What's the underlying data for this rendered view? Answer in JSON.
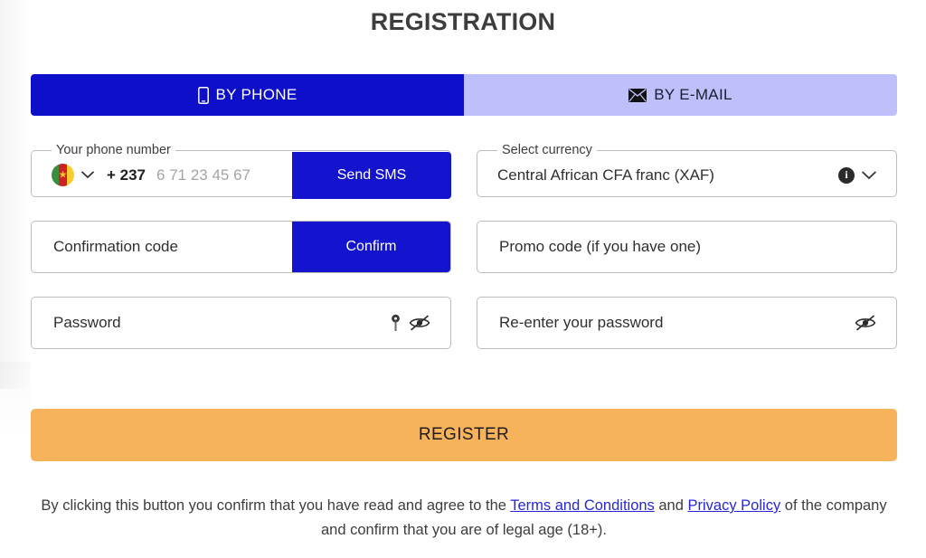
{
  "page": {
    "title": "REGISTRATION"
  },
  "tabs": [
    {
      "label": "BY PHONE",
      "icon": "phone-icon",
      "active": true
    },
    {
      "label": "BY E-MAIL",
      "icon": "envelope-icon",
      "active": false
    }
  ],
  "phone_field": {
    "legend": "Your phone number",
    "flag": "cameroon-flag-icon",
    "country_code": "+ 237",
    "placeholder": "6 71 23 45 67",
    "value": "",
    "button_label": "Send SMS"
  },
  "currency_field": {
    "legend": "Select currency",
    "value": "Central African CFA franc (XAF)",
    "info_icon": "info-icon",
    "chevron_icon": "chevron-down-icon"
  },
  "confirmation_field": {
    "placeholder": "Confirmation code",
    "value": "",
    "button_label": "Confirm"
  },
  "promo_field": {
    "placeholder": "Promo code (if you have one)",
    "value": ""
  },
  "password_field": {
    "placeholder": "Password",
    "value": "",
    "key_icon": "key-icon",
    "toggle_icon": "eye-off-icon"
  },
  "repeat_password_field": {
    "placeholder": "Re-enter your password",
    "value": "",
    "toggle_icon": "eye-off-icon"
  },
  "register_button": {
    "label": "REGISTER"
  },
  "legal": {
    "text_before": "By clicking this button you confirm that you have read and agree to the ",
    "terms_link": "Terms and Conditions",
    "text_middle": " and ",
    "privacy_link": "Privacy Policy",
    "text_after": " of the company and confirm that you are of legal age (18+)."
  },
  "colors": {
    "primary_blue": "#0d10c8",
    "button_blue": "#1414cf",
    "inactive_tab": "#bdc0fb",
    "accent_orange": "#f7b35c",
    "link_blue": "#2727d8",
    "text_dark": "#3d3d3d",
    "border_grey": "#bdbdbd",
    "placeholder_grey": "#a4a4a4"
  }
}
